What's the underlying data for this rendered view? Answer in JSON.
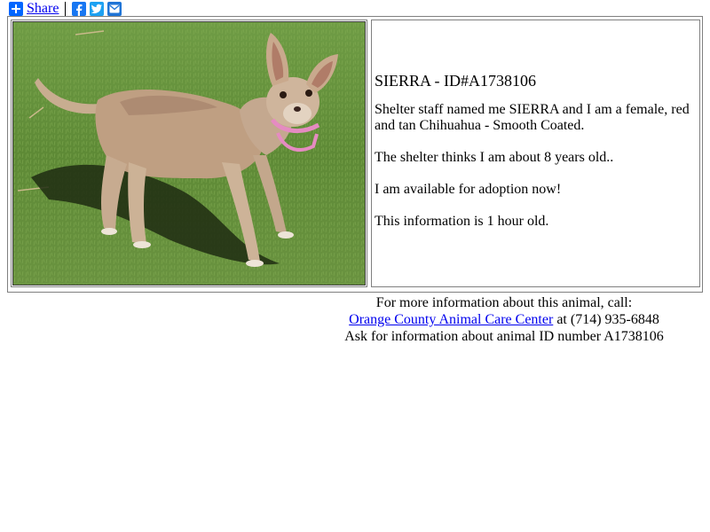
{
  "share": {
    "label": "Share",
    "icons": [
      "plus-icon",
      "facebook-icon",
      "twitter-icon",
      "email-icon"
    ],
    "colors": {
      "plus": "#0166ff",
      "facebook": "#1877f2",
      "twitter": "#1da1f2",
      "email": "#1f74d6"
    }
  },
  "animal": {
    "photo_alt": "dog-photo",
    "title": "SIERRA - ID#A1738106",
    "description": "Shelter staff named me SIERRA and I am a female, red and tan Chihuahua - Smooth Coated.",
    "age": "The shelter thinks I am about 8 years old..",
    "availability": "I am available for adoption now!",
    "freshness": "This information is 1 hour old."
  },
  "contact": {
    "line1": "For more information about this animal, call:",
    "shelter_name": "Orange County Animal Care Center",
    "phone_text": " at (714) 935-6848",
    "line3": "Ask for information about animal ID number A1738106"
  }
}
